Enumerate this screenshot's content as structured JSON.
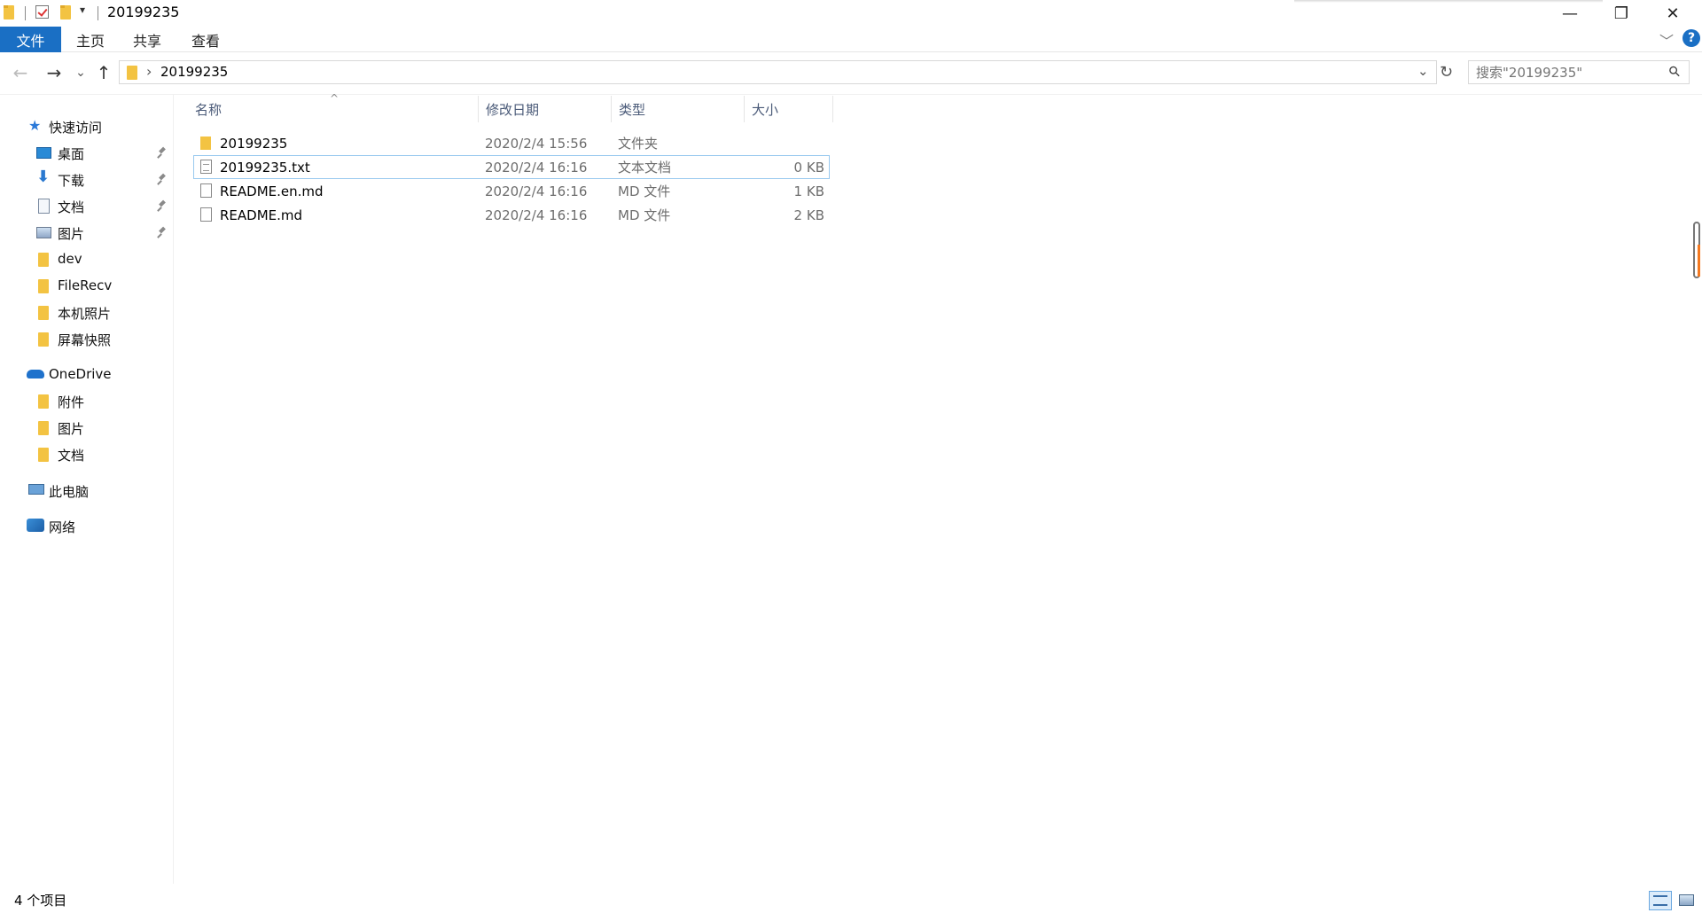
{
  "window": {
    "title": "20199235",
    "quick_access_dropdown": "▾",
    "minimize_glyph": "—",
    "restore_glyph": "❐",
    "close_glyph": "✕"
  },
  "ribbon": {
    "tabs": [
      {
        "label": "文件",
        "active": true
      },
      {
        "label": "主页",
        "active": false
      },
      {
        "label": "共享",
        "active": false
      },
      {
        "label": "查看",
        "active": false
      }
    ],
    "expand_glyph": "﹀",
    "help_glyph": "?"
  },
  "address_bar": {
    "back_glyph": "←",
    "forward_glyph": "→",
    "recent_glyph": "⌄",
    "up_glyph": "↑",
    "breadcrumb_chevron": "›",
    "path": "20199235",
    "dropdown_glyph": "⌄",
    "refresh_glyph": "↻"
  },
  "search": {
    "placeholder": "搜索\"20199235\"",
    "icon_glyph": "⚲"
  },
  "nav_pane": {
    "quick_access": {
      "label": "快速访问",
      "icon": "star-icon"
    },
    "quick_items": [
      {
        "label": "桌面",
        "icon": "desktop-icon",
        "pinned": true
      },
      {
        "label": "下载",
        "icon": "download-icon",
        "pinned": true
      },
      {
        "label": "文档",
        "icon": "documents-icon",
        "pinned": true
      },
      {
        "label": "图片",
        "icon": "pictures-icon",
        "pinned": true
      },
      {
        "label": "dev",
        "icon": "folder-icon",
        "pinned": false
      },
      {
        "label": "FileRecv",
        "icon": "folder-icon",
        "pinned": false
      },
      {
        "label": "本机照片",
        "icon": "folder-icon",
        "pinned": false
      },
      {
        "label": "屏幕快照",
        "icon": "folder-icon",
        "pinned": false
      }
    ],
    "onedrive": {
      "label": "OneDrive",
      "icon": "cloud-icon"
    },
    "onedrive_items": [
      {
        "label": "附件",
        "icon": "folder-icon"
      },
      {
        "label": "图片",
        "icon": "folder-icon"
      },
      {
        "label": "文档",
        "icon": "folder-icon"
      }
    ],
    "this_pc": {
      "label": "此电脑",
      "icon": "computer-icon"
    },
    "network": {
      "label": "网络",
      "icon": "network-icon"
    }
  },
  "file_list": {
    "sort_glyph": "^",
    "columns": [
      {
        "key": "name",
        "label": "名称"
      },
      {
        "key": "modified",
        "label": "修改日期"
      },
      {
        "key": "type",
        "label": "类型"
      },
      {
        "key": "size",
        "label": "大小"
      }
    ],
    "rows": [
      {
        "name": "20199235",
        "modified": "2020/2/4 15:56",
        "type": "文件夹",
        "size": "",
        "icon": "folder-icon",
        "selected": false
      },
      {
        "name": "20199235.txt",
        "modified": "2020/2/4 16:16",
        "type": "文本文档",
        "size": "0 KB",
        "icon": "text-file-icon",
        "selected": true
      },
      {
        "name": "README.en.md",
        "modified": "2020/2/4 16:16",
        "type": "MD 文件",
        "size": "1 KB",
        "icon": "file-icon",
        "selected": false
      },
      {
        "name": "README.md",
        "modified": "2020/2/4 16:16",
        "type": "MD 文件",
        "size": "2 KB",
        "icon": "file-icon",
        "selected": false
      }
    ]
  },
  "status_bar": {
    "item_count": "4 个项目"
  },
  "colors": {
    "accent": "#1a6fc4",
    "folder": "#f3c342",
    "selection_border": "#99c9ef",
    "header_text": "#4a5a78"
  }
}
